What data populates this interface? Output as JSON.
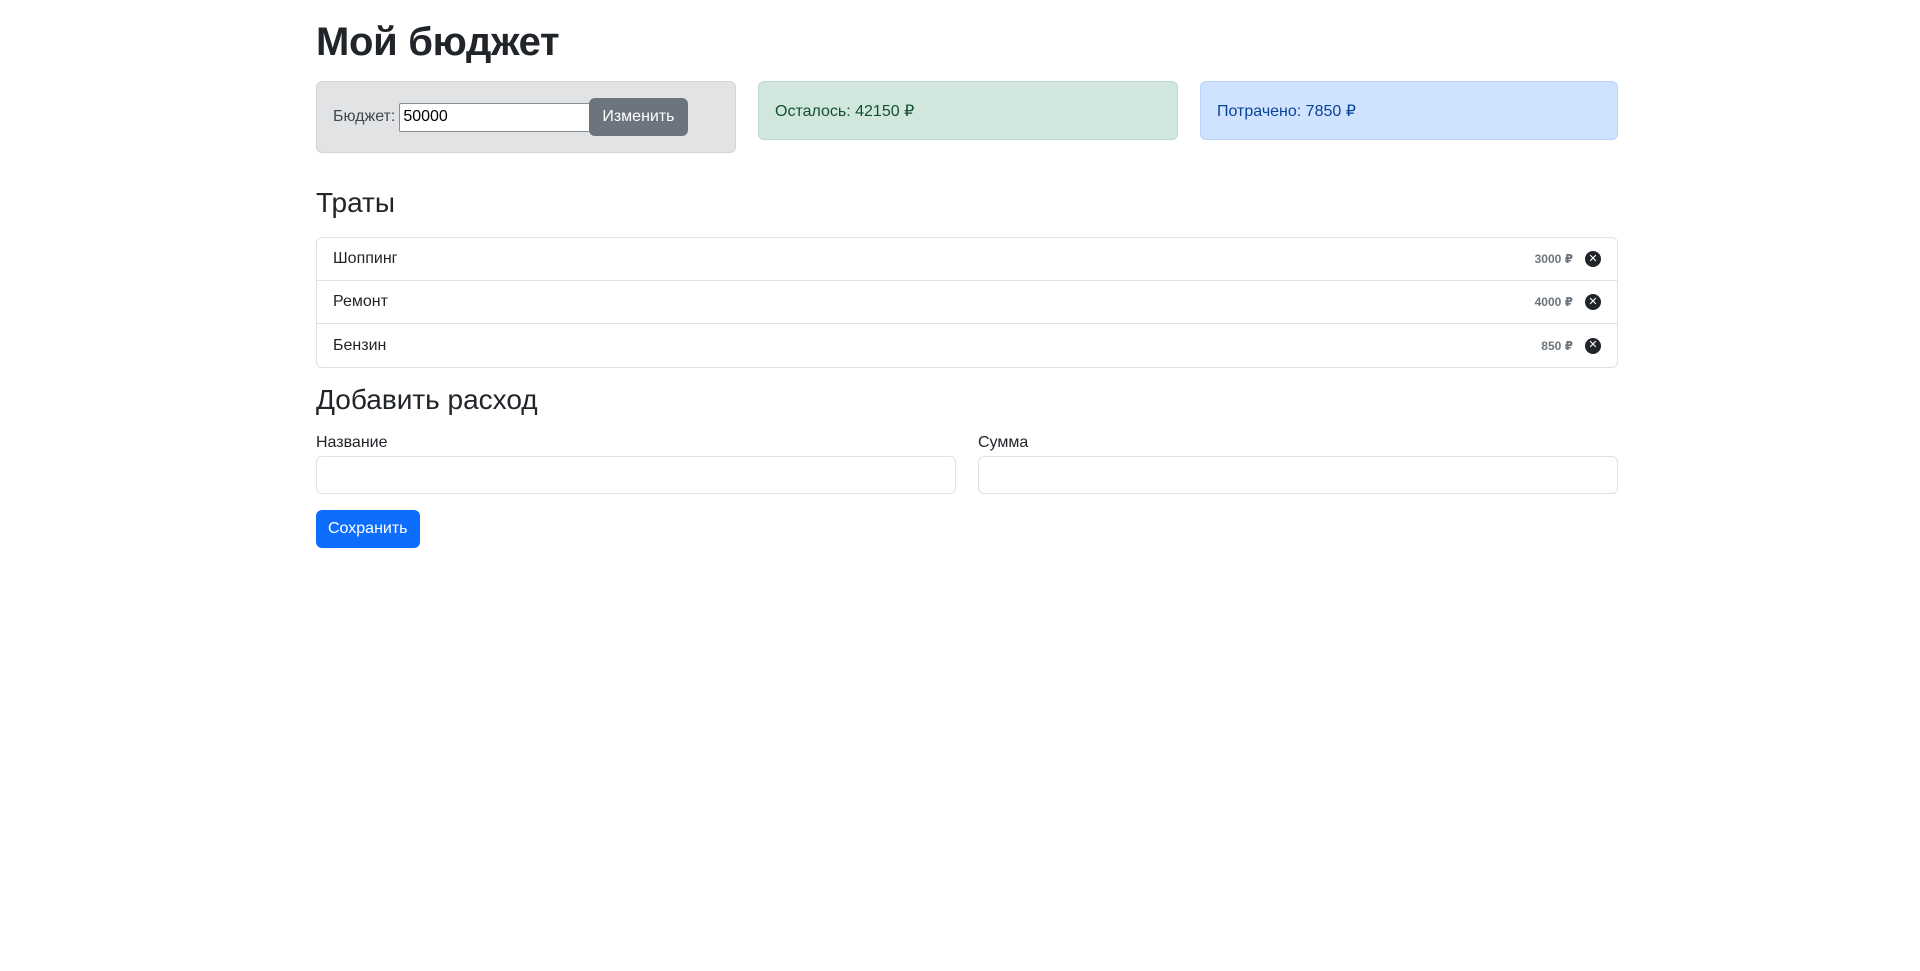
{
  "page": {
    "title": "Мой бюджет"
  },
  "budget": {
    "label": "Бюджет:",
    "value": "50000",
    "button_label": "Изменить"
  },
  "remaining": {
    "text": "Осталось: 42150 ₽"
  },
  "spent": {
    "text": "Потрачено: 7850 ₽"
  },
  "expenses": {
    "title": "Траты",
    "items": [
      {
        "name": "Шоппинг",
        "amount": "3000 ₽"
      },
      {
        "name": "Ремонт",
        "amount": "4000 ₽"
      },
      {
        "name": "Бензин",
        "amount": "850 ₽"
      }
    ]
  },
  "add_form": {
    "title": "Добавить расход",
    "name_label": "Название",
    "name_value": "",
    "sum_label": "Сумма",
    "sum_value": "",
    "save_label": "Сохранить"
  },
  "colors": {
    "primary": "#0d6efd",
    "secondary": "#6c757d",
    "success_bg": "#d1e7dd",
    "info_bg": "#cfe2ff",
    "neutral_bg": "#e2e3e5"
  },
  "icons": {
    "delete": "close-circle-icon"
  }
}
